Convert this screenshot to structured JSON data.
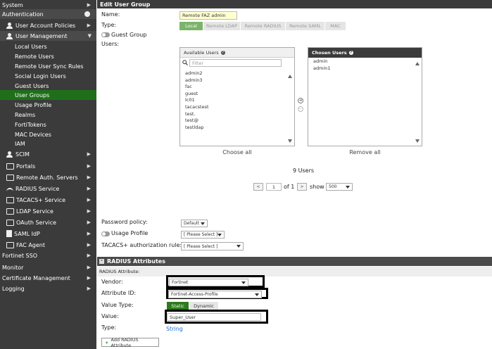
{
  "sidebar": {
    "items": [
      {
        "label": "System",
        "level": "top",
        "arrow": "right"
      },
      {
        "label": "Authentication",
        "level": "top",
        "icon": "gear-icon"
      },
      {
        "label": "User Account Policies",
        "level": "section",
        "icon": "user-icon",
        "arrow": "right"
      },
      {
        "label": "User Management",
        "level": "section",
        "icon": "users-icon",
        "arrow": "down"
      },
      {
        "label": "Local Users",
        "level": "sub"
      },
      {
        "label": "Remote Users",
        "level": "sub"
      },
      {
        "label": "Remote User Sync Rules",
        "level": "sub"
      },
      {
        "label": "Social Login Users",
        "level": "sub"
      },
      {
        "label": "Guest Users",
        "level": "sub"
      },
      {
        "label": "User Groups",
        "level": "sub",
        "active": true
      },
      {
        "label": "Usage Profile",
        "level": "sub"
      },
      {
        "label": "Realms",
        "level": "sub"
      },
      {
        "label": "FortiTokens",
        "level": "sub"
      },
      {
        "label": "MAC Devices",
        "level": "sub"
      },
      {
        "label": "IAM",
        "level": "sub"
      },
      {
        "label": "SCIM",
        "level": "section",
        "icon": "scim-icon",
        "arrow": "right"
      },
      {
        "label": "Portals",
        "level": "section",
        "icon": "portal-icon",
        "arrow": "right"
      },
      {
        "label": "Remote Auth. Servers",
        "level": "section",
        "icon": "server-icon",
        "arrow": "right"
      },
      {
        "label": "RADIUS Service",
        "level": "section",
        "icon": "wifi-icon",
        "arrow": "right"
      },
      {
        "label": "TACACS+ Service",
        "level": "section",
        "icon": "network-icon",
        "arrow": "right"
      },
      {
        "label": "LDAP Service",
        "level": "section",
        "icon": "tree-icon",
        "arrow": "right"
      },
      {
        "label": "OAuth Service",
        "level": "section",
        "icon": "oauth-icon",
        "arrow": "right"
      },
      {
        "label": "SAML IdP",
        "level": "section",
        "icon": "document-icon",
        "arrow": "right"
      },
      {
        "label": "FAC Agent",
        "level": "section",
        "icon": "agent-icon",
        "arrow": "right"
      },
      {
        "label": "Fortinet SSO",
        "level": "top",
        "arrow": "right"
      },
      {
        "label": "Monitor",
        "level": "top",
        "arrow": "right"
      },
      {
        "label": "Certificate Management",
        "level": "top",
        "arrow": "right"
      },
      {
        "label": "Logging",
        "level": "top",
        "arrow": "right"
      }
    ]
  },
  "main": {
    "title": "Edit User Group",
    "name_label": "Name:",
    "name_value": "Remote FAZ admin",
    "type_label": "Type:",
    "type_options": [
      "Local",
      "Remote LDAP",
      "Remote RADIUS",
      "Remote SAML",
      "MAC"
    ],
    "type_selected": "Local",
    "guest_group_label": "Guest Group",
    "users_label": "Users:",
    "available": {
      "header": "Available Users",
      "filter_placeholder": "Filter",
      "items": [
        "admin2",
        "admin3",
        "fac",
        "guest",
        "lc01",
        "tacacstest",
        "test.",
        "test@",
        "testldap"
      ],
      "choose_all": "Choose all"
    },
    "chosen": {
      "header": "Chosen Users",
      "items": [
        "admin",
        "admin1"
      ],
      "remove_all": "Remove all"
    },
    "count_text": "9 Users",
    "pager": {
      "prev": "<",
      "page": "1",
      "of_text": "of 1",
      "next": ">",
      "show_label": "show",
      "show_value": "500"
    },
    "password_policy_label": "Password policy:",
    "password_policy_value": "Default",
    "usage_profile_label": "Usage Profile",
    "usage_profile_value": "[ Please Select ]",
    "tacacs_label": "TACACS+ authorization rule:",
    "tacacs_value": "[ Please Select ]"
  },
  "radius": {
    "section_title": "RADIUS Attributes",
    "sub_header": "RADIUS Attribute:",
    "vendor_label": "Vendor:",
    "vendor_value": "Fortinet",
    "attr_id_label": "Attribute ID:",
    "attr_id_value": "Fortinet-Access-Profile",
    "value_type_label": "Value Type:",
    "value_type_options": [
      "Static",
      "Dynamic"
    ],
    "value_type_selected": "Static",
    "value_label": "Value:",
    "value_value": "Super_User",
    "type_label": "Type:",
    "type_value": "String",
    "add_button": "Add RADIUS Attribute"
  }
}
